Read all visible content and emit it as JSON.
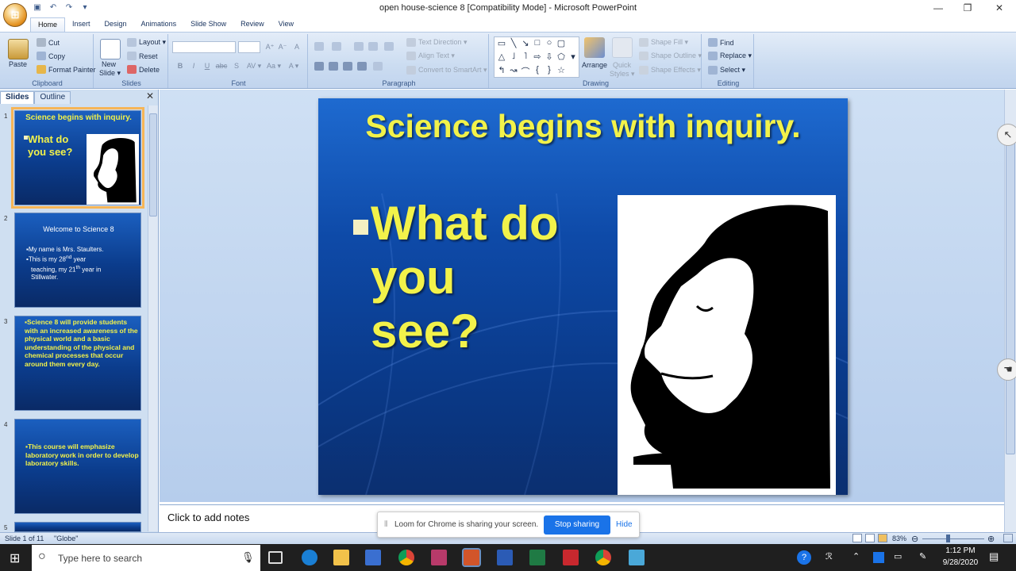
{
  "window": {
    "title": "open house-science 8 [Compatibility Mode] - Microsoft PowerPoint",
    "minimize": "—",
    "maximize": "❐",
    "close": "✕"
  },
  "tabs": [
    "Home",
    "Insert",
    "Design",
    "Animations",
    "Slide Show",
    "Review",
    "View"
  ],
  "ribbon": {
    "clipboard": {
      "paste": "Paste",
      "cut": "Cut",
      "copy": "Copy",
      "format_painter": "Format Painter",
      "label": "Clipboard"
    },
    "slides": {
      "new_slide": "New",
      "new_slide2": "Slide ▾",
      "layout": "Layout ▾",
      "reset": "Reset",
      "delete": "Delete",
      "label": "Slides"
    },
    "font": {
      "label": "Font",
      "bold": "B",
      "italic": "I",
      "underline": "U",
      "strike": "abc",
      "shadow": "S",
      "spacing": "AV ▾",
      "case": "Aa ▾",
      "color": "A ▾",
      "grow": "A⁺",
      "shrink": "A⁻",
      "clear": "A"
    },
    "paragraph": {
      "text_direction": "Text Direction ▾",
      "align_text": "Align Text ▾",
      "convert_smartart": "Convert to SmartArt ▾",
      "label": "Paragraph"
    },
    "drawing": {
      "arrange": "Arrange",
      "quick_styles": "Quick",
      "quick_styles2": "Styles ▾",
      "shape_fill": "Shape Fill ▾",
      "shape_outline": "Shape Outline ▾",
      "shape_effects": "Shape Effects ▾",
      "label": "Drawing"
    },
    "editing": {
      "find": "Find",
      "replace": "Replace ▾",
      "select": "Select ▾",
      "label": "Editing"
    }
  },
  "left_pane": {
    "tab_slides": "Slides",
    "tab_outline": "Outline",
    "close": "✕",
    "thumbs": [
      {
        "num": "1",
        "title": "Science begins with inquiry.",
        "text": "What do you see?"
      },
      {
        "num": "2",
        "title": "Welcome to Science 8",
        "line1": "My name is Mrs. Staulters.",
        "line2a": "This is my 28",
        "line2b": "nd",
        "line2c": " year",
        "line3a": "teaching, my 21",
        "line3b": "th",
        "line3c": " year in",
        "line4": "Stillwater."
      },
      {
        "num": "3",
        "text": "Science 8 will provide students with an increased awareness of the physical world and a basic understanding  of the physical and chemical processes that occur around them every day."
      },
      {
        "num": "4",
        "text": "This course will emphasize laboratory work in order to develop laboratory skills."
      },
      {
        "num": "5"
      }
    ]
  },
  "slide": {
    "title": "Science begins with inquiry.",
    "bullet": "What do you see?",
    "bullet_mark": "■"
  },
  "notes": {
    "placeholder": "Click to add notes"
  },
  "status": {
    "slide": "Slide 1 of 11",
    "theme": "\"Globe\"",
    "zoom": "83%"
  },
  "loom": {
    "message": "Loom for Chrome is sharing your screen.",
    "stop": "Stop sharing",
    "hide": "Hide"
  },
  "taskbar": {
    "search": "Type here to search",
    "time": "1:12 PM",
    "date": "9/28/2020"
  },
  "colors": {
    "slide_text": "#f2f24a",
    "accent_blue": "#1a73e8",
    "ribbon": "#cbdcf1"
  }
}
